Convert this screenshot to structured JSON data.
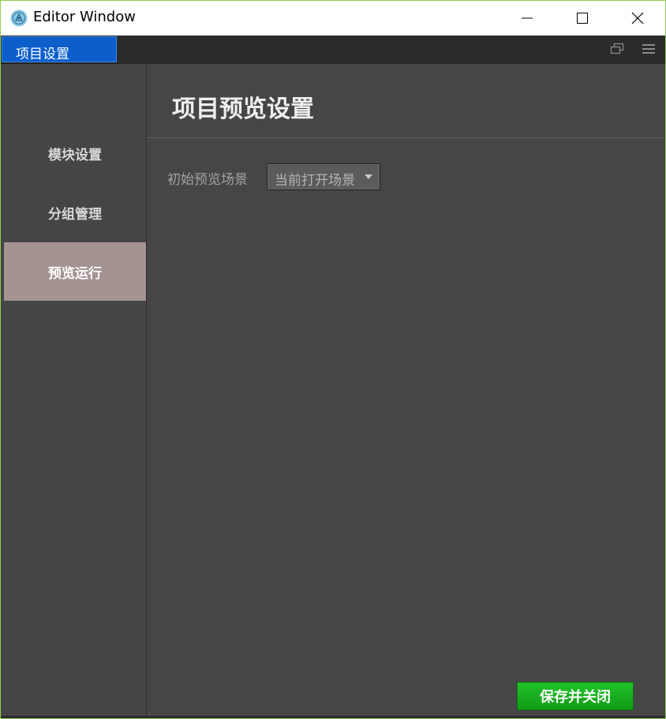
{
  "window": {
    "title": "Editor Window",
    "icon": "editor-app-icon",
    "border_color": "#8fd14f"
  },
  "tabs": [
    {
      "label": "项目设置",
      "active": true
    }
  ],
  "sidebar": {
    "items": [
      {
        "label": "模块设置",
        "active": false
      },
      {
        "label": "分组管理",
        "active": false
      },
      {
        "label": "预览运行",
        "active": true
      }
    ]
  },
  "main": {
    "title": "项目预览设置",
    "fields": [
      {
        "label": "初始预览场景",
        "value": "当前打开场景"
      }
    ],
    "save_label": "保存并关闭"
  },
  "colors": {
    "tab_active": "#0c5ecb",
    "nav_active": "#a39492",
    "save_button": "#1aa822",
    "background": "#454545"
  }
}
